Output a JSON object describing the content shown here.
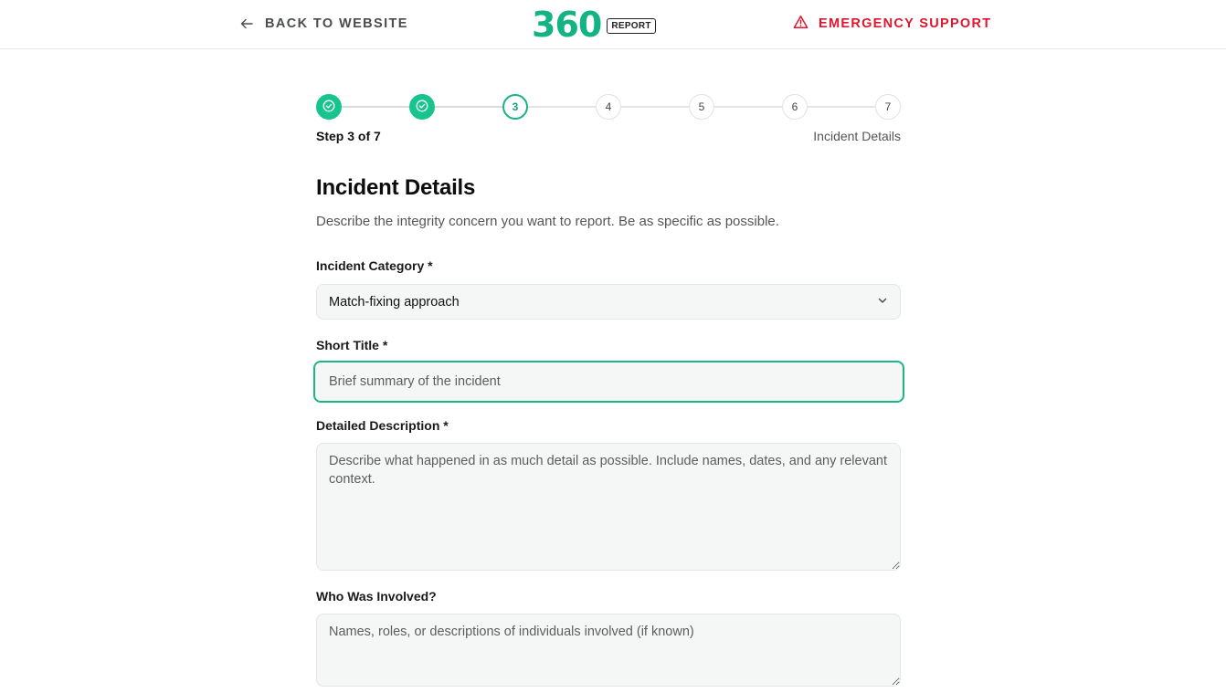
{
  "header": {
    "back_label": "BACK TO WEBSITE",
    "logo_text": "360",
    "logo_badge": "REPORT",
    "emergency_label": "EMERGENCY SUPPORT"
  },
  "stepper": {
    "steps": [
      "",
      "",
      "3",
      "4",
      "5",
      "6",
      "7"
    ],
    "states": [
      "done",
      "done",
      "current",
      "pending",
      "pending",
      "pending",
      "pending"
    ],
    "step_count": "Step 3 of 7",
    "step_name": "Incident Details"
  },
  "page": {
    "title": "Incident Details",
    "description": "Describe the integrity concern you want to report. Be as specific as possible."
  },
  "form": {
    "category": {
      "label": "Incident Category *",
      "value": "Match-fixing approach"
    },
    "short_title": {
      "label": "Short Title *",
      "placeholder": "Brief summary of the incident",
      "value": ""
    },
    "description": {
      "label": "Detailed Description *",
      "placeholder": "Describe what happened in as much detail as possible. Include names, dates, and any relevant context.",
      "value": ""
    },
    "involved": {
      "label": "Who Was Involved?",
      "placeholder": "Names, roles, or descriptions of individuals involved (if known)",
      "value": ""
    }
  },
  "colors": {
    "brand": "#14b384",
    "step_done": "#18c48e",
    "emergency": "#e0162d",
    "focus_border": "#1bb586"
  },
  "icons": {
    "back": "arrow-left-icon",
    "emergency": "warning-triangle-icon",
    "select": "chevron-down-icon",
    "step_done": "check-circle-icon"
  }
}
